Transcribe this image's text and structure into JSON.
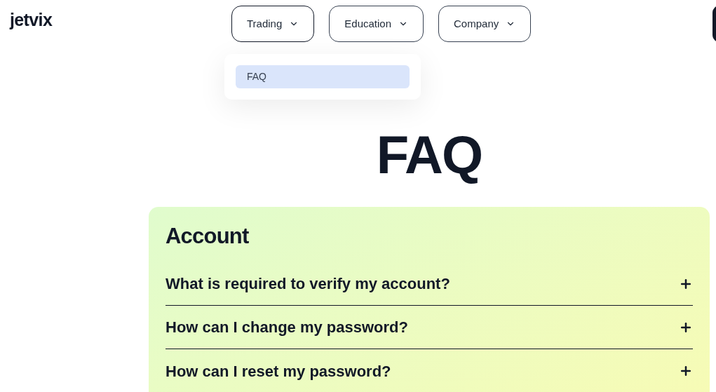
{
  "logo": "jetvix",
  "nav": [
    {
      "label": "Trading",
      "expanded": true,
      "menu": [
        {
          "label": "FAQ",
          "highlighted": true
        }
      ]
    },
    {
      "label": "Education",
      "expanded": false
    },
    {
      "label": "Company",
      "expanded": false
    }
  ],
  "page_title": "FAQ",
  "section": {
    "title": "Account",
    "questions": [
      {
        "text": "What is required to verify my account?",
        "expanded": false
      },
      {
        "text": "How can I change my password?",
        "expanded": false
      },
      {
        "text": "How can I reset my password?",
        "expanded": false
      }
    ]
  }
}
